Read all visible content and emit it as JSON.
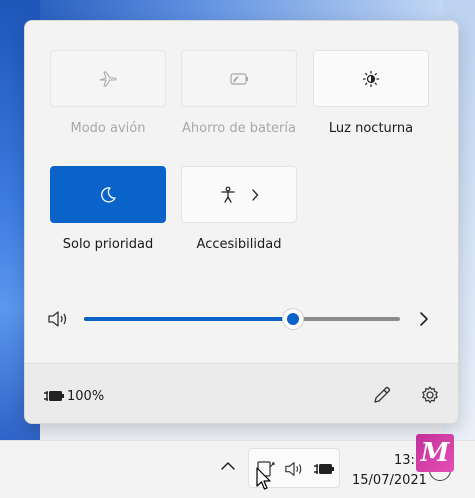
{
  "quick_settings": {
    "tiles": [
      {
        "label": "Modo avión",
        "icon": "airplane-icon",
        "state": "disabled"
      },
      {
        "label": "Ahorro de batería",
        "icon": "battery-saver-icon",
        "state": "disabled"
      },
      {
        "label": "Luz nocturna",
        "icon": "night-light-icon",
        "state": "off"
      },
      {
        "label": "Solo prioridad",
        "icon": "moon-icon",
        "state": "on"
      },
      {
        "label": "Accesibilidad",
        "icon": "accessibility-icon",
        "state": "off",
        "has_chevron": true
      }
    ],
    "volume": {
      "icon": "speaker-icon",
      "level_percent": 66,
      "chevron_icon": "chevron-right-icon"
    },
    "footer": {
      "battery_icon": "battery-plugged-icon",
      "battery_text": "100%",
      "edit_icon": "pencil-icon",
      "settings_icon": "gear-icon"
    }
  },
  "taskbar": {
    "overflow_icon": "chevron-up-icon",
    "tray_icons": [
      "network-icon",
      "speaker-icon",
      "battery-plugged-icon"
    ],
    "clock": {
      "time": "13:1",
      "date": "15/07/2021"
    },
    "badge_letter": "M"
  },
  "colors": {
    "accent": "#0a63c9",
    "panel_bg": "#f3f3f3",
    "badge": "#d13fa8"
  }
}
